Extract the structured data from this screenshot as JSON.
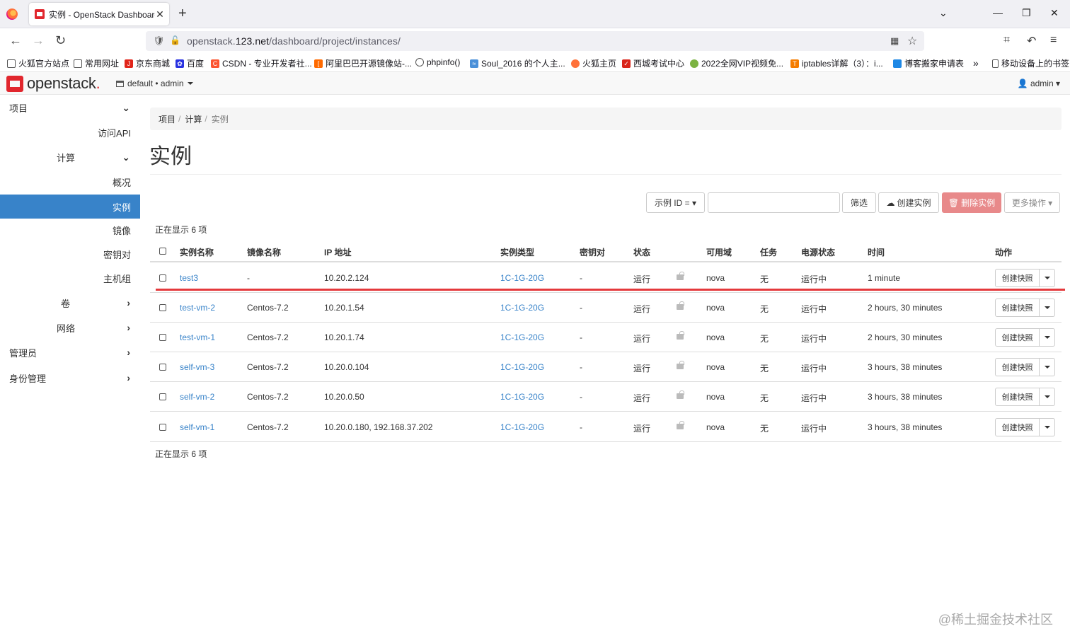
{
  "browser": {
    "tab_title": "实例 - OpenStack Dashboard",
    "url_prefix": "openstack.",
    "url_host": "123.net",
    "url_path": "/dashboard/project/instances/",
    "bookmarks": [
      "火狐官方站点",
      "常用网址",
      "京东商城",
      "百度",
      "CSDN - 专业开发者社...",
      "阿里巴巴开源镜像站-...",
      "phpinfo()",
      "Soul_2016 的个人主...",
      "火狐主页",
      "西城考试中心",
      "2022全网VIP视频免...",
      "iptables详解（3）：i...",
      "博客搬家申请表"
    ],
    "bookmarks_mobile": "移动设备上的书签"
  },
  "header": {
    "logo_text": "openstack",
    "project_selector": "default • admin",
    "user": "admin"
  },
  "sidebar": {
    "project": "项目",
    "access_api": "访问API",
    "compute": "计算",
    "overview": "概况",
    "instances": "实例",
    "images": "镜像",
    "keypairs": "密钥对",
    "server_groups": "主机组",
    "volumes": "卷",
    "network": "网络",
    "admin": "管理员",
    "identity": "身份管理"
  },
  "breadcrumb": [
    "项目",
    "计算",
    "实例"
  ],
  "page_title": "实例",
  "toolbar": {
    "filter_select": "示例 ID = ▾",
    "filter_button": "筛选",
    "create_button": "创建实例",
    "delete_button": "删除实例",
    "more_button": "更多操作 ▾"
  },
  "count_text": "正在显示 6 项",
  "table": {
    "headers": [
      "实例名称",
      "镜像名称",
      "IP 地址",
      "实例类型",
      "密钥对",
      "状态",
      "可用域",
      "任务",
      "电源状态",
      "时间",
      "动作"
    ],
    "rows": [
      {
        "name": "test3",
        "image": "-",
        "ip": "10.20.2.124",
        "flavor": "1C-1G-20G",
        "key": "-",
        "status": "运行",
        "az": "nova",
        "task": "无",
        "power": "运行中",
        "time": "1 minute",
        "action": "创建快照"
      },
      {
        "name": "test-vm-2",
        "image": "Centos-7.2",
        "ip": "10.20.1.54",
        "flavor": "1C-1G-20G",
        "key": "-",
        "status": "运行",
        "az": "nova",
        "task": "无",
        "power": "运行中",
        "time": "2 hours, 30 minutes",
        "action": "创建快照"
      },
      {
        "name": "test-vm-1",
        "image": "Centos-7.2",
        "ip": "10.20.1.74",
        "flavor": "1C-1G-20G",
        "key": "-",
        "status": "运行",
        "az": "nova",
        "task": "无",
        "power": "运行中",
        "time": "2 hours, 30 minutes",
        "action": "创建快照"
      },
      {
        "name": "self-vm-3",
        "image": "Centos-7.2",
        "ip": "10.20.0.104",
        "flavor": "1C-1G-20G",
        "key": "-",
        "status": "运行",
        "az": "nova",
        "task": "无",
        "power": "运行中",
        "time": "3 hours, 38 minutes",
        "action": "创建快照"
      },
      {
        "name": "self-vm-2",
        "image": "Centos-7.2",
        "ip": "10.20.0.50",
        "flavor": "1C-1G-20G",
        "key": "-",
        "status": "运行",
        "az": "nova",
        "task": "无",
        "power": "运行中",
        "time": "3 hours, 38 minutes",
        "action": "创建快照"
      },
      {
        "name": "self-vm-1",
        "image": "Centos-7.2",
        "ip": "10.20.0.180, 192.168.37.202",
        "flavor": "1C-1G-20G",
        "key": "-",
        "status": "运行",
        "az": "nova",
        "task": "无",
        "power": "运行中",
        "time": "3 hours, 38 minutes",
        "action": "创建快照"
      }
    ]
  },
  "watermark": "@稀土掘金技术社区",
  "colors": {
    "active": "#3883c9",
    "danger": "#e8898a",
    "brand": "#e1262d",
    "annotation": "#e4393c"
  }
}
